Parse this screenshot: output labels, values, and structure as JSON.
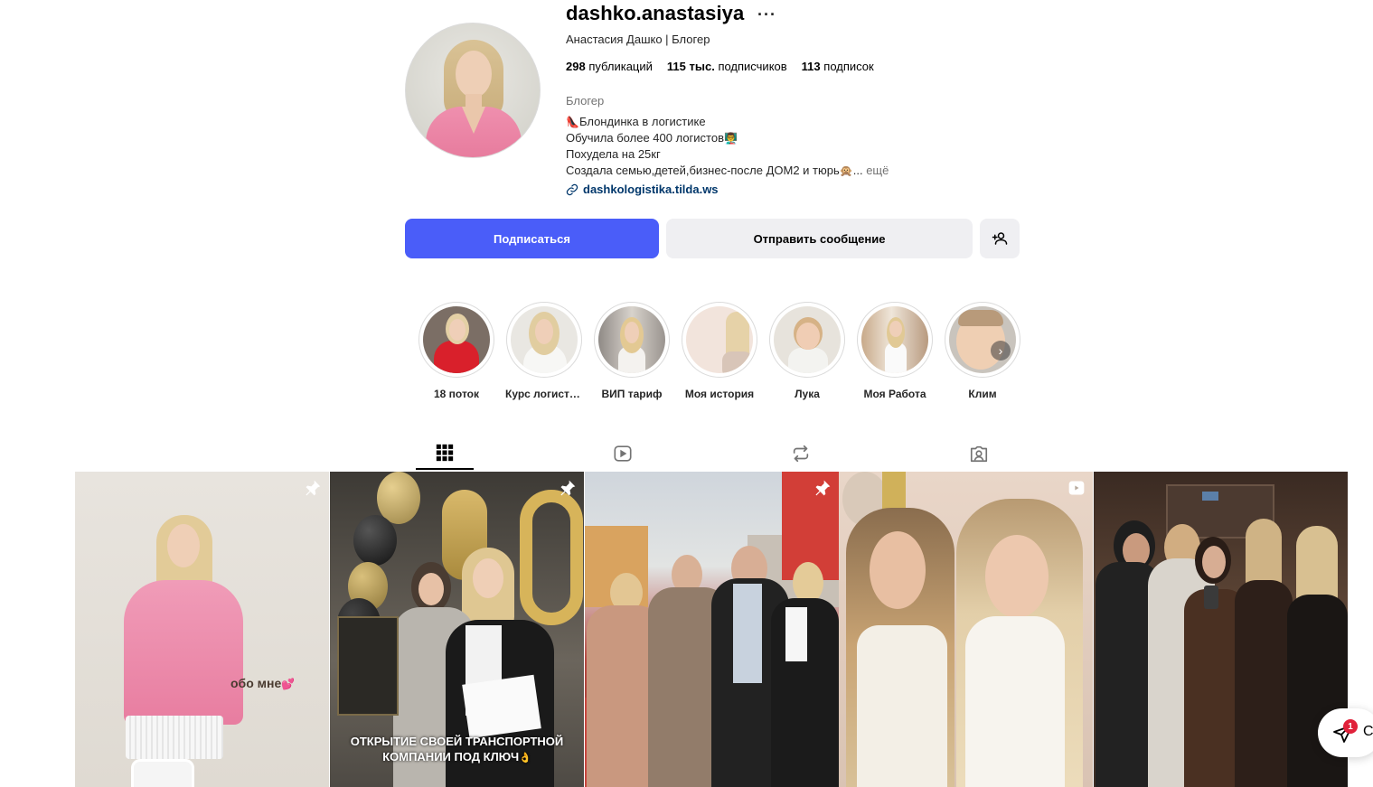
{
  "profile": {
    "username": "dashko.anastasiya",
    "more": "···",
    "full_name": "Анастасия Дашко | Блогер",
    "stats": {
      "posts_count": "298",
      "posts_label": "публикаций",
      "followers_count": "115 тыс.",
      "followers_label": "подписчиков",
      "following_count": "113",
      "following_label": "подписок"
    },
    "category": "Блогер",
    "bio": {
      "line1_emoji": "👠",
      "line1": "Блондинка в логистике",
      "line2": "Обучила более 400 логистов",
      "line2_emoji": "👨‍🏫",
      "line3": "Похудела на 25кг",
      "line4": "Создала семью,детей,бизнес-после ДОМ2 и тюрь",
      "line4_emoji": "🙊",
      "ellipsis": "...",
      "more": "ещё"
    },
    "link": "dashkologistika.tilda.ws"
  },
  "actions": {
    "follow": "Подписаться",
    "message": "Отправить сообщение"
  },
  "highlights": [
    {
      "label": "18 поток"
    },
    {
      "label": "Курс логисти..."
    },
    {
      "label": "ВИП тариф"
    },
    {
      "label": "Моя история"
    },
    {
      "label": "Лука"
    },
    {
      "label": "Моя Работа"
    },
    {
      "label": "Клим"
    }
  ],
  "tabs": [
    "posts",
    "reels",
    "reposts",
    "tagged"
  ],
  "posts": [
    {
      "caption": "обо мне",
      "caption_emoji": "💕",
      "badge": "pin-icon"
    },
    {
      "caption_line1": "ОТКРЫТИЕ СВОЕЙ ТРАНСПОРТНОЙ",
      "caption_line2": "КОМПАНИИ ПОД КЛЮЧ",
      "caption_emoji": "👌",
      "badge": "pin-icon"
    },
    {
      "badge": "pin-icon"
    },
    {
      "badge": "reel-icon"
    },
    {}
  ],
  "chat": {
    "notifications": "1",
    "label_fragment": "С"
  },
  "colors": {
    "accent": "#4a5df9",
    "secondary_button": "#efeff2",
    "link": "#00376b"
  }
}
